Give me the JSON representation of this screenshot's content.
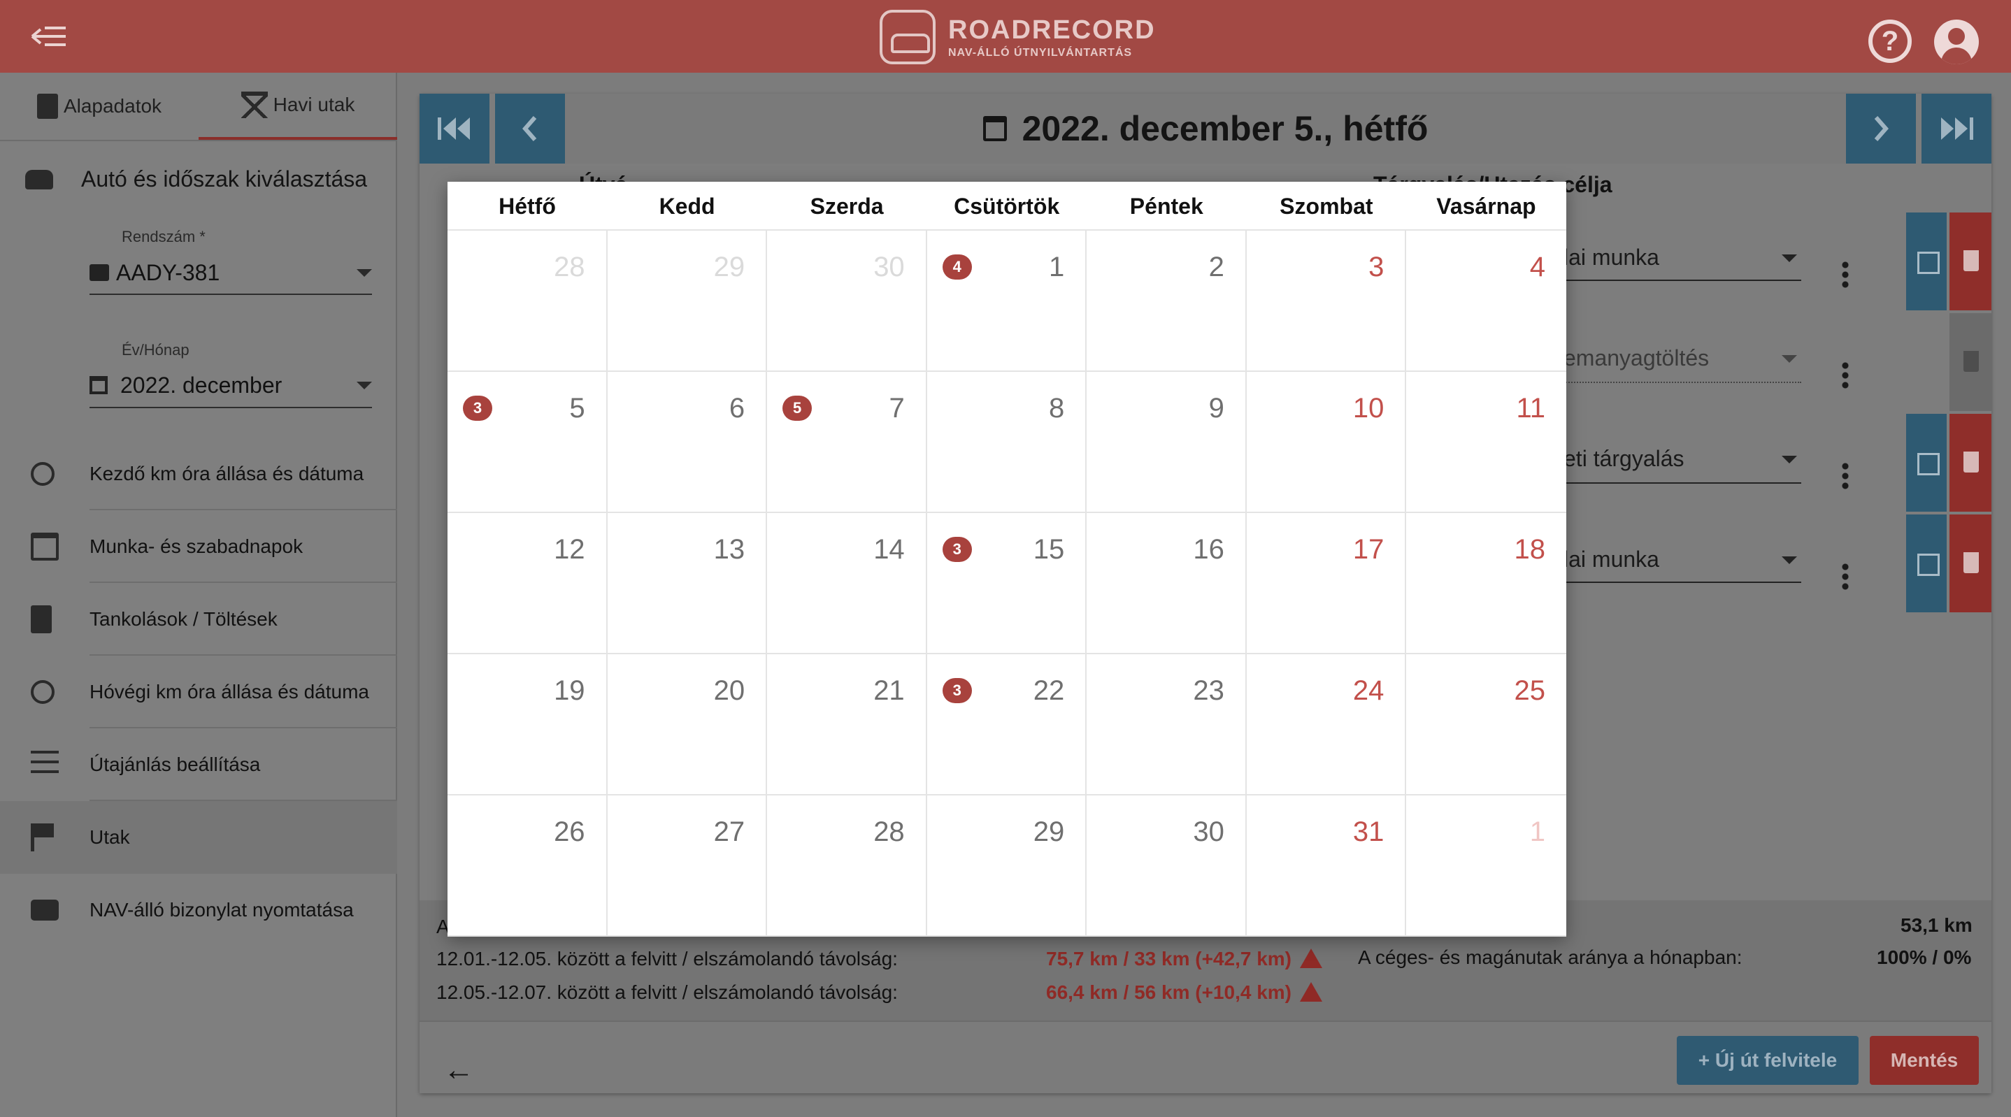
{
  "app": {
    "brand_name": "ROADRECORD",
    "brand_tagline": "NAV-ÁLLÓ ÚTNYILVÁNTARTÁS",
    "help_icon_glyph": "?"
  },
  "sidebar": {
    "tabs": [
      {
        "label": "Alapadatok",
        "icon": "clipboard-icon"
      },
      {
        "label": "Havi utak",
        "icon": "road-icon"
      }
    ],
    "section_title": "Autó és időszak kiválasztása",
    "plate_label": "Rendszám *",
    "plate_value": "AADY-381",
    "month_label": "Év/Hónap",
    "month_value": "2022. december",
    "menu": [
      {
        "label": "Kezdő km óra állása és dátuma",
        "icon": "odometer-start-icon"
      },
      {
        "label": "Munka- és szabadnapok",
        "icon": "calendar-icon"
      },
      {
        "label": "Tankolások / Töltések",
        "icon": "fuel-icon"
      },
      {
        "label": "Hóvégi km óra állása és dátuma",
        "icon": "odometer-end-icon"
      },
      {
        "label": "Útajánlás beállítása",
        "icon": "tune-icon"
      },
      {
        "label": "Utak",
        "icon": "flag-icon"
      },
      {
        "label": "NAV-álló bizonylat nyomtatása",
        "icon": "print-icon"
      }
    ]
  },
  "main": {
    "date_title": "2022. december 5., hétfő",
    "column_headers": [
      "Útvá",
      "Tárgyalás/Utazás célja"
    ],
    "trips": [
      {
        "purpose": "lai munka",
        "disabled": false
      },
      {
        "purpose": "emanyagtöltés",
        "disabled": true
      },
      {
        "purpose": "eti tárgyalás",
        "disabled": false
      },
      {
        "purpose": "lai munka",
        "disabled": false
      }
    ],
    "summary": {
      "row0_left": "A",
      "row1_label": "12.01.-12.05. között a felvitt / elszámolandó távolság:",
      "row1_value": "75,7 km / 33 km (+42,7 km)",
      "row2_label": "12.05.-12.07. között a felvitt / elszámolandó távolság:",
      "row2_value": "66,4 km / 56 km (+10,4 km)",
      "total_km": "53,1 km",
      "ratio_label": "A céges- és magánutak aránya a hónapban:",
      "ratio_value": "100% / 0%"
    },
    "new_trip_label": "+ Új út felvitele",
    "save_label": "Mentés",
    "back_glyph": "←"
  },
  "calendar": {
    "weekdays": [
      "Hétfő",
      "Kedd",
      "Szerda",
      "Csütörtök",
      "Péntek",
      "Szombat",
      "Vasárnap"
    ],
    "weeks": [
      [
        {
          "d": "28",
          "o": true
        },
        {
          "d": "29",
          "o": true
        },
        {
          "d": "30",
          "o": true
        },
        {
          "d": "1",
          "b": "4"
        },
        {
          "d": "2"
        },
        {
          "d": "3",
          "w": true
        },
        {
          "d": "4",
          "w": true
        }
      ],
      [
        {
          "d": "5",
          "b": "3"
        },
        {
          "d": "6"
        },
        {
          "d": "7",
          "b": "5"
        },
        {
          "d": "8"
        },
        {
          "d": "9"
        },
        {
          "d": "10",
          "w": true
        },
        {
          "d": "11",
          "w": true
        }
      ],
      [
        {
          "d": "12"
        },
        {
          "d": "13"
        },
        {
          "d": "14"
        },
        {
          "d": "15",
          "b": "3"
        },
        {
          "d": "16"
        },
        {
          "d": "17",
          "w": true
        },
        {
          "d": "18",
          "w": true
        }
      ],
      [
        {
          "d": "19"
        },
        {
          "d": "20"
        },
        {
          "d": "21"
        },
        {
          "d": "22",
          "b": "3"
        },
        {
          "d": "23"
        },
        {
          "d": "24",
          "w": true
        },
        {
          "d": "25",
          "w": true
        }
      ],
      [
        {
          "d": "26"
        },
        {
          "d": "27"
        },
        {
          "d": "28"
        },
        {
          "d": "29"
        },
        {
          "d": "30"
        },
        {
          "d": "31",
          "w": true
        },
        {
          "d": "1",
          "w": true,
          "o": true
        }
      ]
    ]
  },
  "colors": {
    "brand_red": "#c0504a",
    "accent_blue": "#4a8ab0",
    "weekend_red": "#c2504b",
    "badge_red": "#a8423d"
  }
}
